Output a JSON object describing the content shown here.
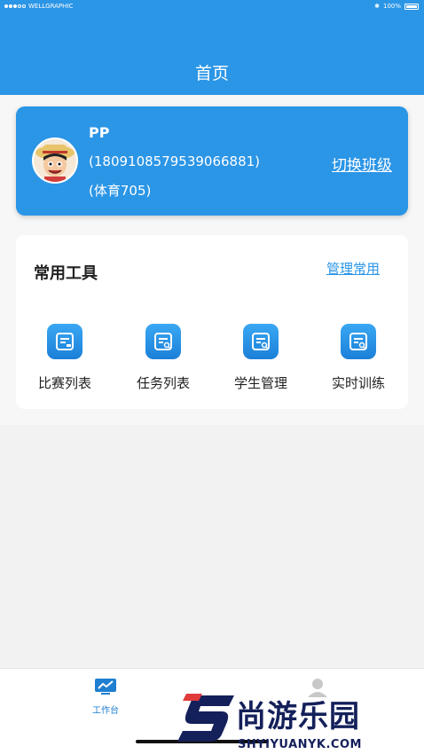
{
  "status_bar": {
    "carrier": "WELLGRAPHIC",
    "battery": "100%"
  },
  "header": {
    "title": "首页"
  },
  "profile": {
    "name": "PP",
    "phone": "(18091085795390668​81)",
    "class_name": "(体育705)",
    "switch_label": "切换班级"
  },
  "tools": {
    "title": "常用工具",
    "manage_label": "管理常用",
    "items": [
      {
        "label": "比赛列表",
        "icon": "list-doc-icon"
      },
      {
        "label": "任务列表",
        "icon": "search-doc-icon"
      },
      {
        "label": "学生管理",
        "icon": "search-doc-icon"
      },
      {
        "label": "实时训练",
        "icon": "search-doc-icon"
      }
    ]
  },
  "tabbar": {
    "tabs": [
      {
        "label": "工作台",
        "icon": "chart-monitor-icon",
        "active": true
      },
      {
        "label": "",
        "icon": "user-icon",
        "active": false
      }
    ]
  },
  "watermark": {
    "brand": "尚游乐园",
    "url": "SHYIYUANYK.COM"
  },
  "colors": {
    "primary": "#2b95e6",
    "background": "#f2f2f2",
    "card": "#ffffff"
  }
}
